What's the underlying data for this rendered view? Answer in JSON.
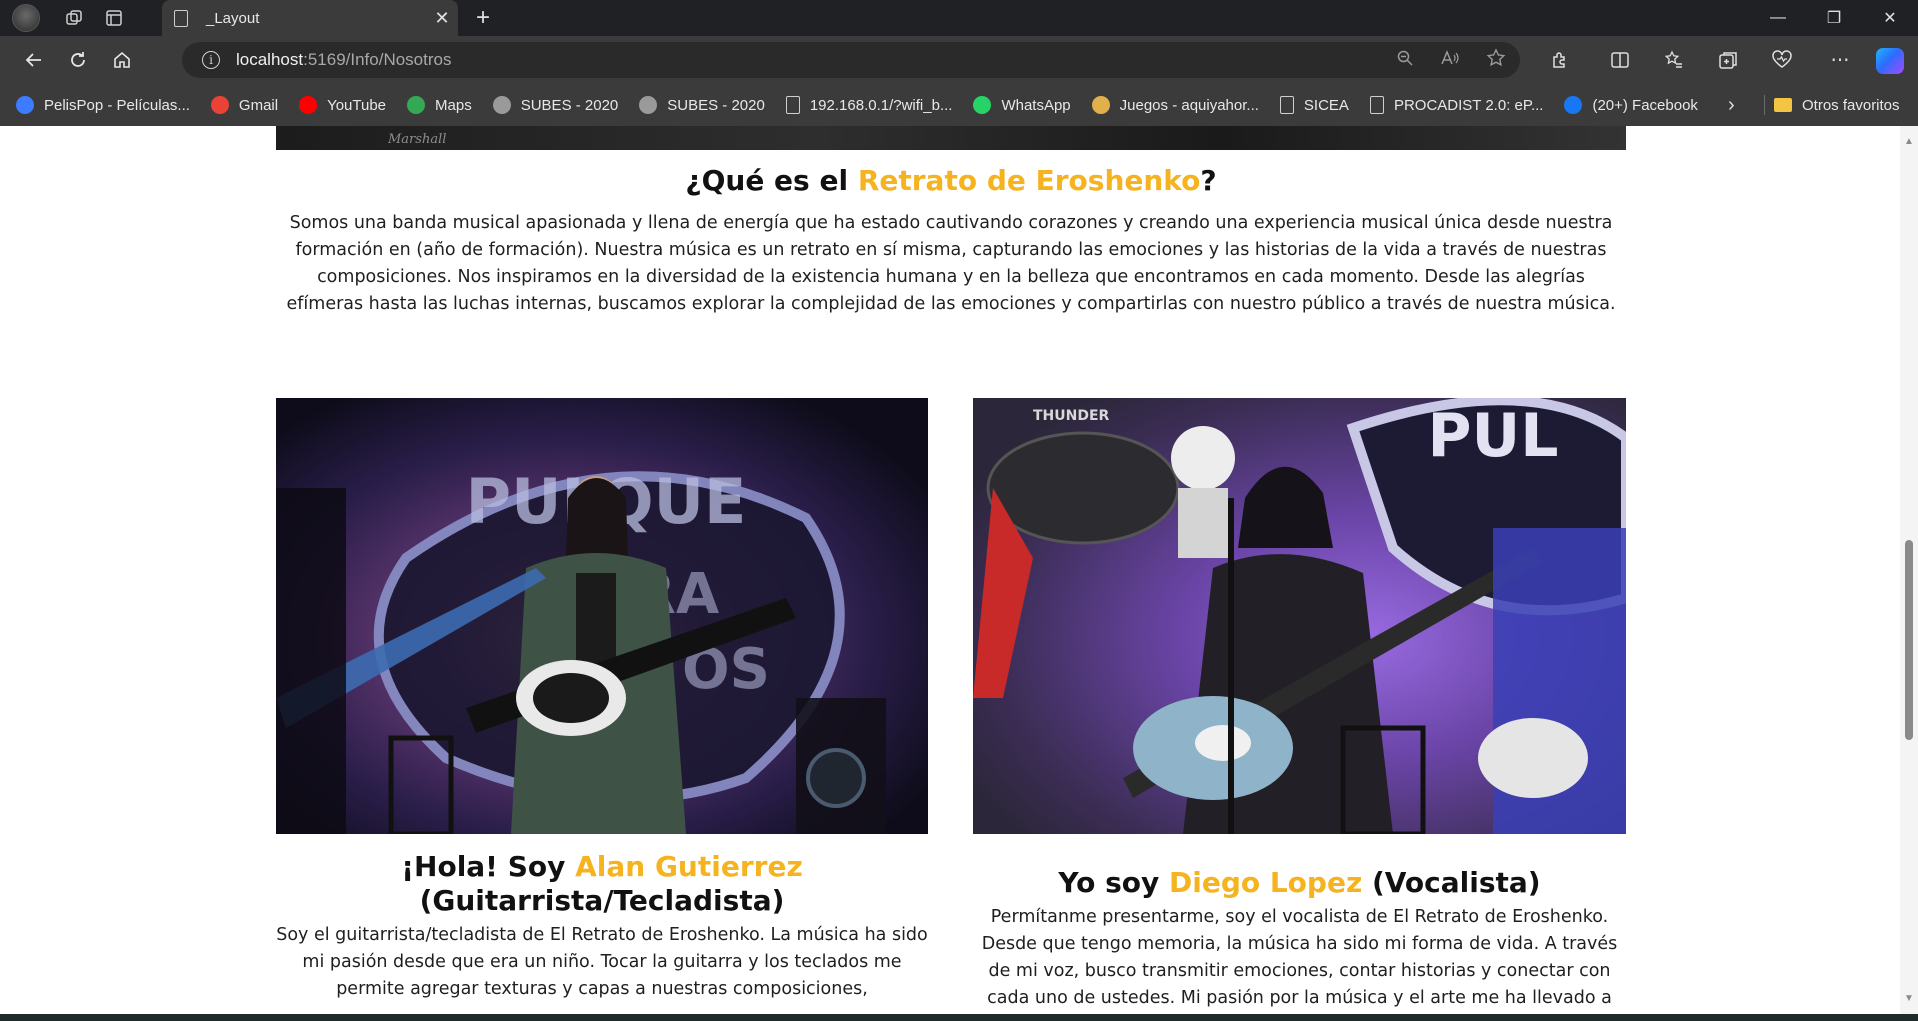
{
  "browser": {
    "tab": {
      "title": "_Layout",
      "close_glyph": "✕"
    },
    "new_tab_glyph": "+",
    "window_controls": {
      "minimize": "—",
      "restore": "❐",
      "close": "✕"
    },
    "address": {
      "host": "localhost",
      "rest": ":5169/Info/Nosotros"
    },
    "bookmarks": [
      {
        "label": "PelisPop - Películas...",
        "icon": "play-circle-icon",
        "color": "#3d7bff"
      },
      {
        "label": "Gmail",
        "icon": "gmail-icon",
        "color": "#ea4335"
      },
      {
        "label": "YouTube",
        "icon": "youtube-icon",
        "color": "#ff0000"
      },
      {
        "label": "Maps",
        "icon": "maps-pin-icon",
        "color": "#34a853"
      },
      {
        "label": "SUBES - 2020",
        "icon": "site-icon",
        "color": "#9a9a9a"
      },
      {
        "label": "SUBES - 2020",
        "icon": "site-icon",
        "color": "#9a9a9a"
      },
      {
        "label": "192.168.0.1/?wifi_b...",
        "icon": "document-icon",
        "color": ""
      },
      {
        "label": "WhatsApp",
        "icon": "whatsapp-icon",
        "color": "#25d366"
      },
      {
        "label": "Juegos - aquiyahor...",
        "icon": "games-icon",
        "color": "#e2b04a"
      },
      {
        "label": "SICEA",
        "icon": "document-icon",
        "color": ""
      },
      {
        "label": "PROCADIST 2.0: eP...",
        "icon": "document-icon",
        "color": ""
      },
      {
        "label": "(20+) Facebook",
        "icon": "facebook-icon",
        "color": "#1877f2"
      }
    ],
    "other_favorites": "Otros favoritos"
  },
  "page": {
    "hero_caption": "Marshall",
    "about": {
      "title_prefix": "¿Qué es el ",
      "title_highlight": "Retrato de Eroshenko",
      "title_suffix": "?",
      "body": "Somos una banda musical apasionada y llena de energía que ha estado cautivando corazones y creando una experiencia musical única desde nuestra formación en (año de formación). Nuestra música es un retrato en sí misma, capturando las emociones y las historias de la vida a través de nuestras composiciones. Nos inspiramos en la diversidad de la existencia humana y en la belleza que encontramos en cada momento. Desde las alegrías efímeras hasta las luchas internas, buscamos explorar la complejidad de las emociones y compartirlas con nuestro público a través de nuestra música."
    },
    "members": [
      {
        "name_prefix": "¡Hola! Soy ",
        "name_highlight": "Alan Gutierrez",
        "name_suffix": " (Guitarrista/Tecladista)",
        "bio": "Soy el guitarrista/tecladista de El Retrato de Eroshenko. La música ha sido mi pasión desde que era un niño. Tocar la guitarra y los teclados me permite agregar texturas y capas a nuestras composiciones,",
        "photo_sign_text": "PULQUE PARA DIOS"
      },
      {
        "name_prefix": "Yo soy ",
        "name_highlight": "Diego Lopez",
        "name_suffix": " (Vocalista)",
        "bio": "Permítanme presentarme, soy el vocalista de El Retrato de Eroshenko. Desde que tengo memoria, la música ha sido mi forma de vida. A través de mi voz, busco transmitir emociones, contar historias y conectar con cada uno de ustedes. Mi pasión por la música y el arte me ha llevado a",
        "photo_sign_text": "PUL",
        "photo_drum_text": "THUNDER"
      }
    ]
  },
  "colors": {
    "accent": "#f5b320",
    "chrome": "#3b3b3b",
    "titlebar": "#202124"
  }
}
